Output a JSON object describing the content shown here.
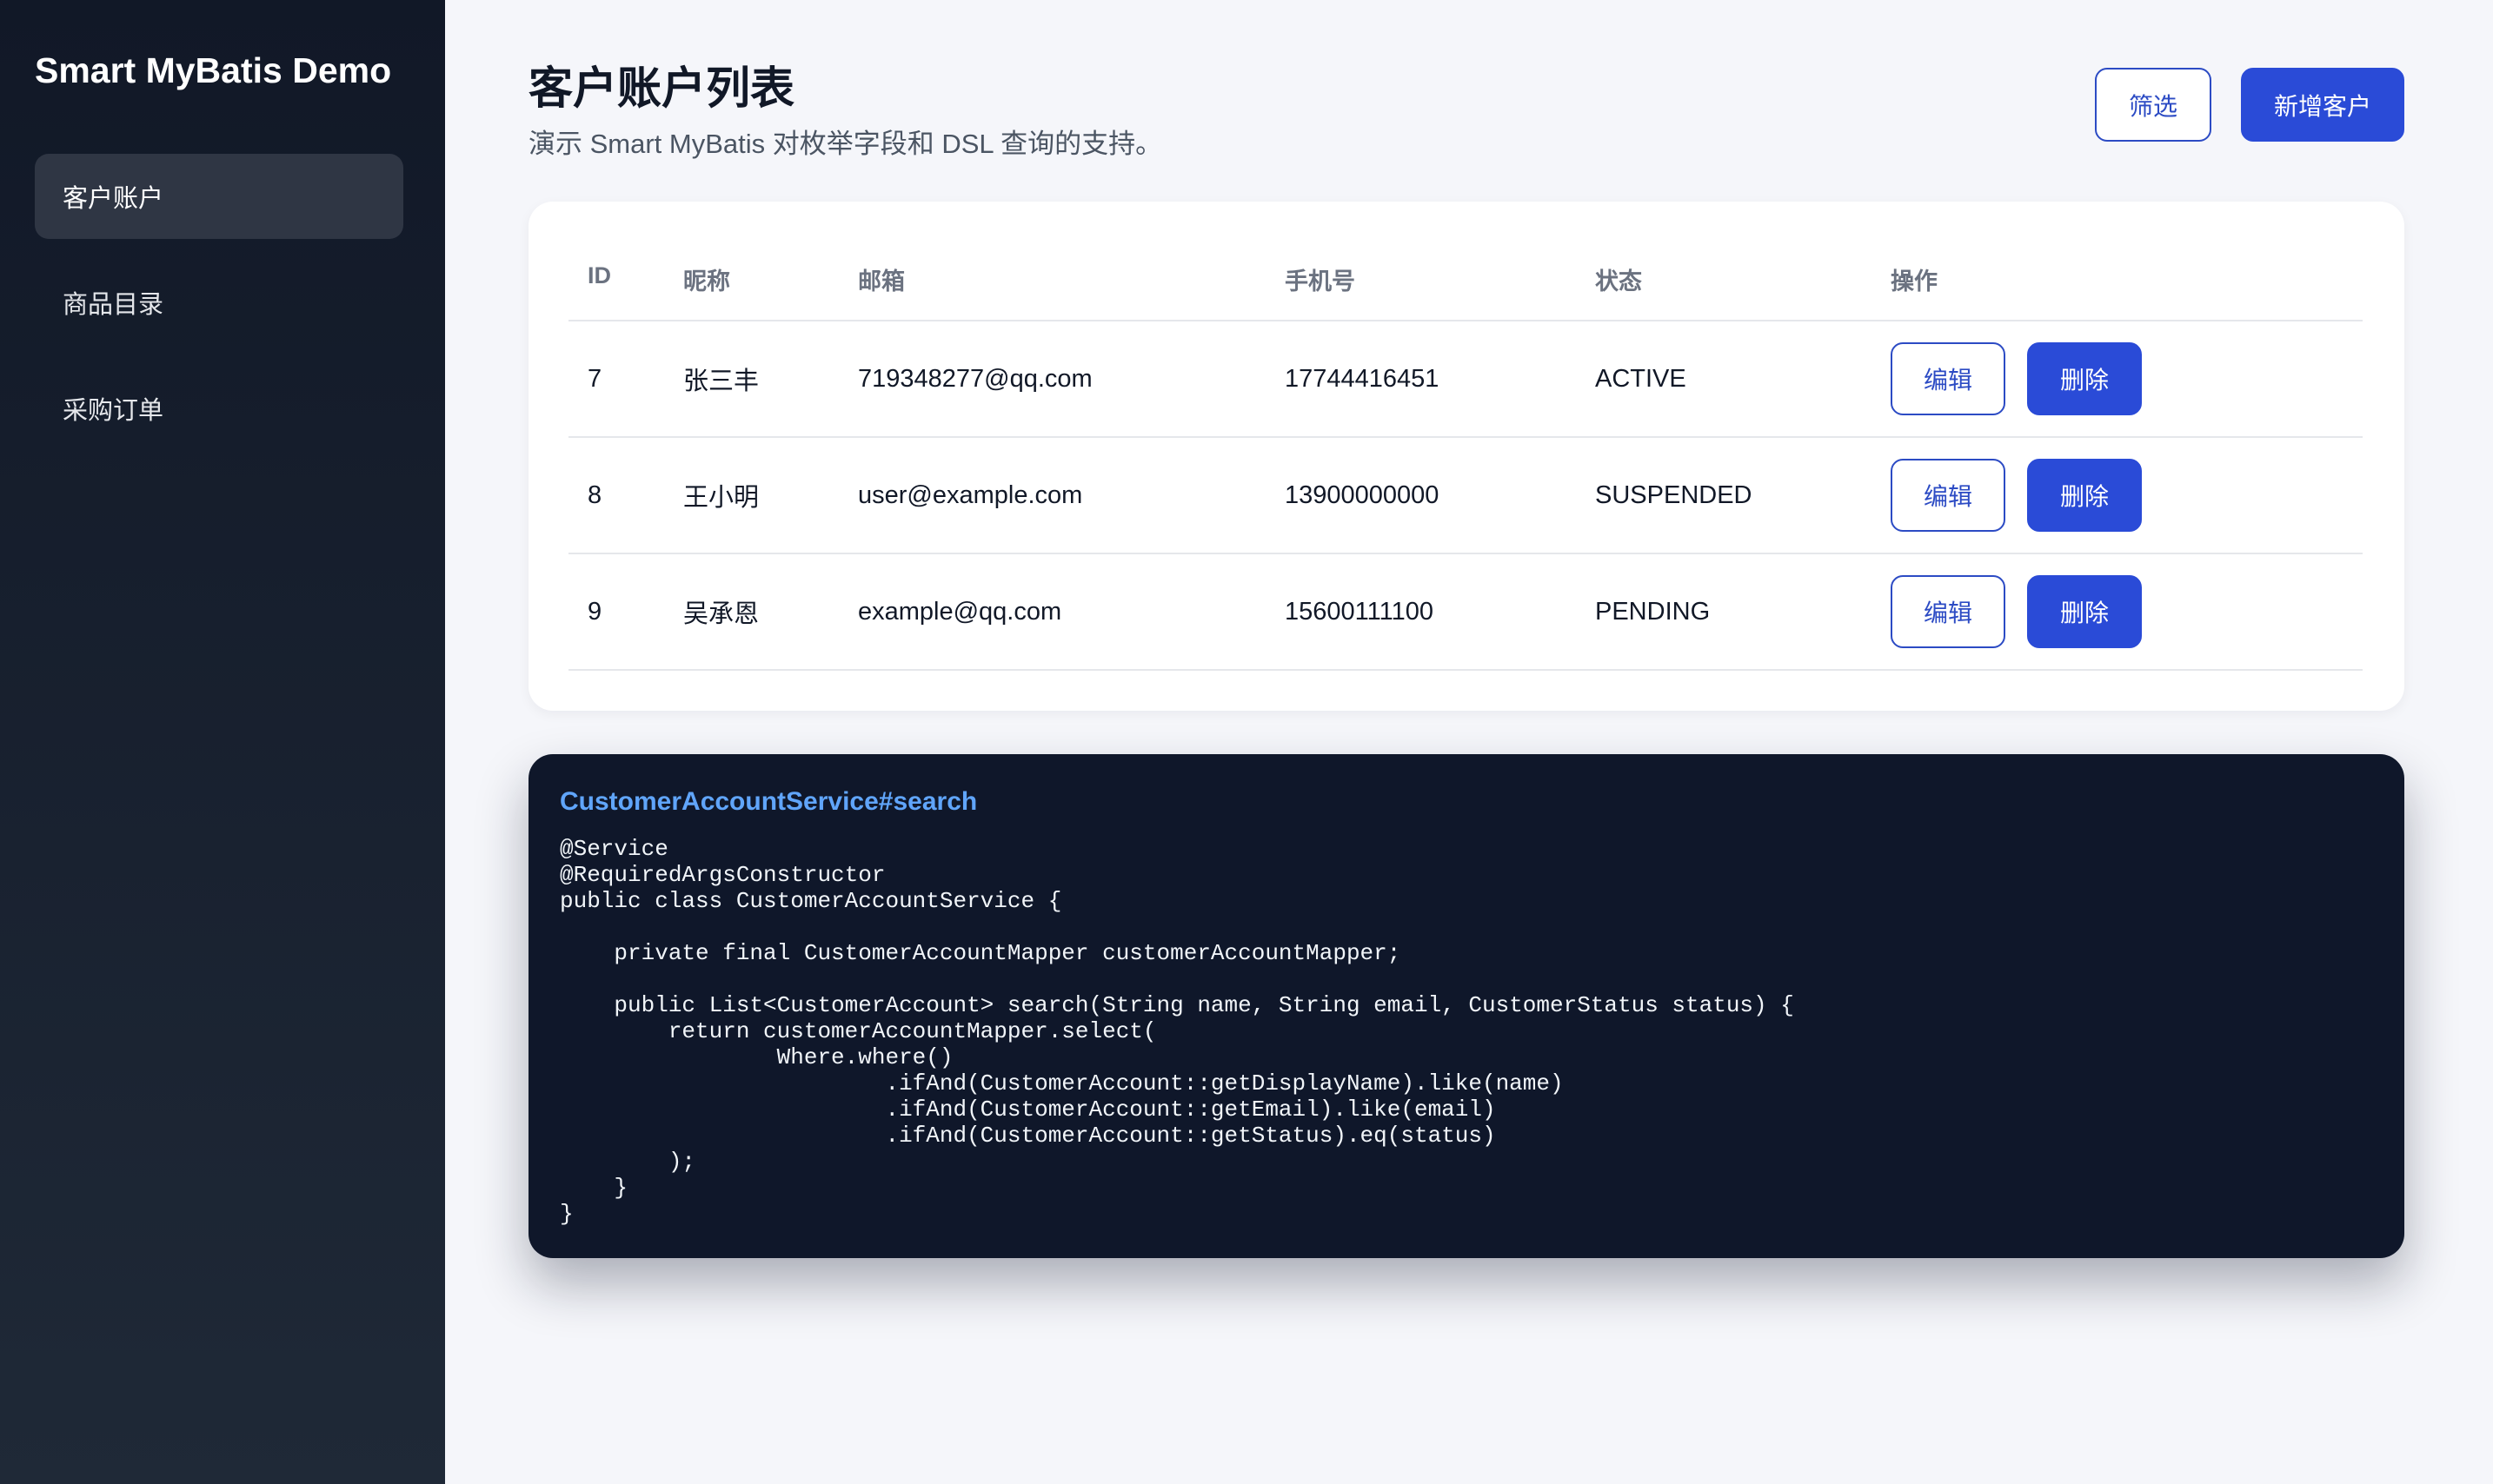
{
  "sidebar": {
    "brand": "Smart MyBatis Demo",
    "items": [
      {
        "label": "客户账户",
        "active": true
      },
      {
        "label": "商品目录",
        "active": false
      },
      {
        "label": "采购订单",
        "active": false
      }
    ]
  },
  "header": {
    "title": "客户账户列表",
    "subtitle": "演示 Smart MyBatis 对枚举字段和 DSL 查询的支持。",
    "filter_label": "筛选",
    "add_label": "新增客户"
  },
  "table": {
    "columns": [
      "ID",
      "昵称",
      "邮箱",
      "手机号",
      "状态",
      "操作"
    ],
    "rows": [
      {
        "id": "7",
        "nickname": "张三丰",
        "email": "719348277@qq.com",
        "phone": "17744416451",
        "status": "ACTIVE",
        "edit": "编辑",
        "delete": "删除"
      },
      {
        "id": "8",
        "nickname": "王小明",
        "email": "user@example.com",
        "phone": "13900000000",
        "status": "SUSPENDED",
        "edit": "编辑",
        "delete": "删除"
      },
      {
        "id": "9",
        "nickname": "吴承恩",
        "email": "example@qq.com",
        "phone": "15600111100",
        "status": "PENDING",
        "edit": "编辑",
        "delete": "删除"
      }
    ]
  },
  "code": {
    "title": "CustomerAccountService#search",
    "body": "@Service\n@RequiredArgsConstructor\npublic class CustomerAccountService {\n\n    private final CustomerAccountMapper customerAccountMapper;\n\n    public List<CustomerAccount> search(String name, String email, CustomerStatus status) {\n        return customerAccountMapper.select(\n                Where.where()\n                        .ifAnd(CustomerAccount::getDisplayName).like(name)\n                        .ifAnd(CustomerAccount::getEmail).like(email)\n                        .ifAnd(CustomerAccount::getStatus).eq(status)\n        );\n    }\n}"
  },
  "colors": {
    "accent": "#2a4bd7",
    "sidebar_bg": "#111827",
    "code_bg": "#0f172a",
    "code_title": "#60a5fa"
  }
}
